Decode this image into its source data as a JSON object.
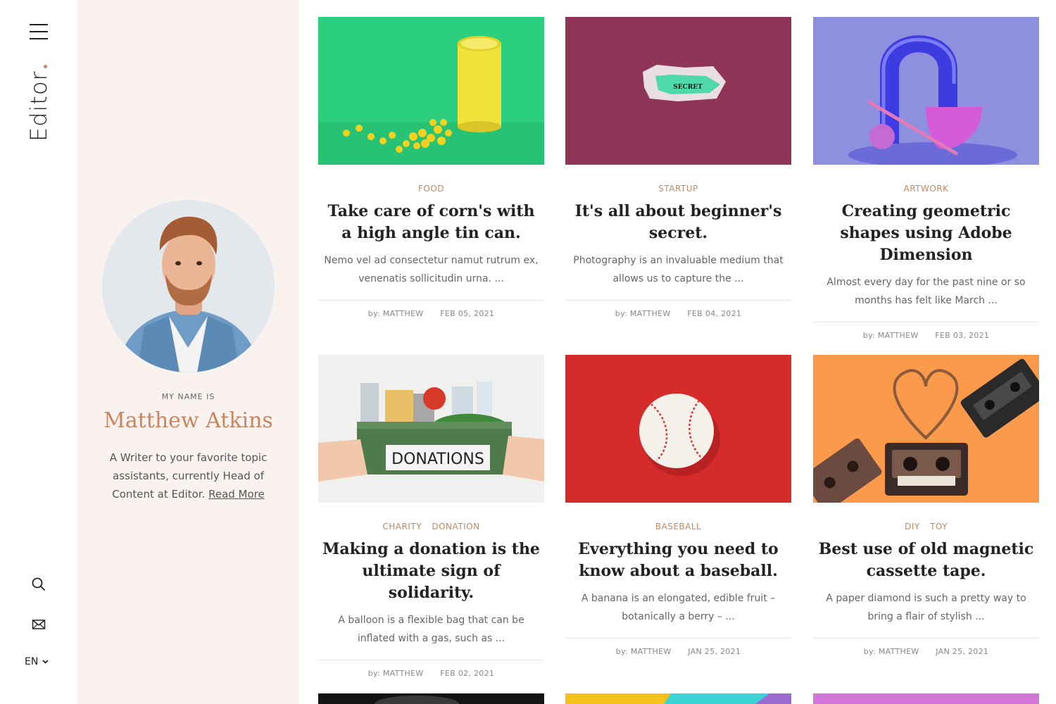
{
  "rail": {
    "logo": "Editor",
    "lang": "EN"
  },
  "profile": {
    "eyebrow": "MY NAME IS",
    "name": "Matthew Atkins",
    "bio": "A Writer to your favorite topic assistants, currently Head of Content at Editor.",
    "read_more": "Read More"
  },
  "posts": [
    {
      "categories": [
        "FOOD"
      ],
      "title": "Take care of corn's with a high angle tin can.",
      "excerpt": "Nemo vel ad consectetur namut rutrum ex, venenatis sollicitudin urna. ...",
      "author": "by: MATTHEW",
      "date": "FEB 05, 2021"
    },
    {
      "categories": [
        "STARTUP"
      ],
      "title": "It's all about beginner's secret.",
      "excerpt": "Photography is an invaluable medium that allows us to capture the ...",
      "author": "by: MATTHEW",
      "date": "FEB 04, 2021",
      "image_text": "SECRET"
    },
    {
      "categories": [
        "ARTWORK"
      ],
      "title": "Creating geometric shapes using Adobe Dimension",
      "excerpt": "Almost every day for the past nine or so months has felt like March ...",
      "author": "by: MATTHEW",
      "date": "FEB 03, 2021"
    },
    {
      "categories": [
        "CHARITY",
        "DONATION"
      ],
      "title": "Making a donation is the ultimate sign of solidarity.",
      "excerpt": "A balloon is a flexible bag that can be inflated with a gas, such as ...",
      "author": "by: MATTHEW",
      "date": "FEB 02, 2021",
      "image_text": "DONATIONS"
    },
    {
      "categories": [
        "BASEBALL"
      ],
      "title": "Everything you need to know about a baseball.",
      "excerpt": "A banana is an elongated, edible fruit – botanically a berry – ...",
      "author": "by: MATTHEW",
      "date": "JAN 25, 2021"
    },
    {
      "categories": [
        "DIY",
        "TOY"
      ],
      "title": "Best use of old magnetic cassette tape.",
      "excerpt": "A paper diamond is such a pretty way to bring a flair of stylish ...",
      "author": "by: MATTHEW",
      "date": "JAN 25, 2021"
    }
  ],
  "colors": {
    "accent": "#c8865f",
    "profile_bg": "#faf2ef"
  }
}
